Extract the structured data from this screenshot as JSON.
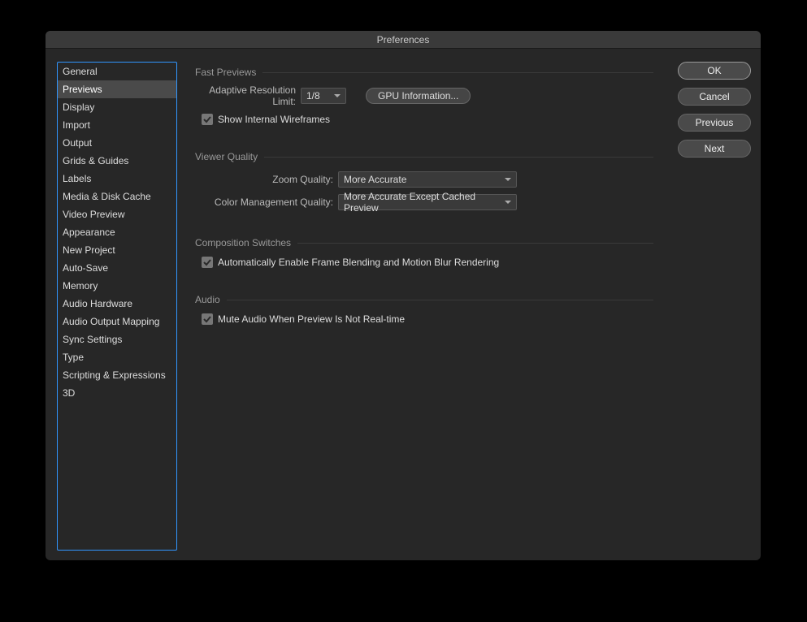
{
  "dialog": {
    "title": "Preferences"
  },
  "sidebar": {
    "items": [
      {
        "label": "General",
        "selected": false
      },
      {
        "label": "Previews",
        "selected": true
      },
      {
        "label": "Display",
        "selected": false
      },
      {
        "label": "Import",
        "selected": false
      },
      {
        "label": "Output",
        "selected": false
      },
      {
        "label": "Grids & Guides",
        "selected": false
      },
      {
        "label": "Labels",
        "selected": false
      },
      {
        "label": "Media & Disk Cache",
        "selected": false
      },
      {
        "label": "Video Preview",
        "selected": false
      },
      {
        "label": "Appearance",
        "selected": false
      },
      {
        "label": "New Project",
        "selected": false
      },
      {
        "label": "Auto-Save",
        "selected": false
      },
      {
        "label": "Memory",
        "selected": false
      },
      {
        "label": "Audio Hardware",
        "selected": false
      },
      {
        "label": "Audio Output Mapping",
        "selected": false
      },
      {
        "label": "Sync Settings",
        "selected": false
      },
      {
        "label": "Type",
        "selected": false
      },
      {
        "label": "Scripting & Expressions",
        "selected": false
      },
      {
        "label": "3D",
        "selected": false
      }
    ]
  },
  "panels": {
    "fastPreviews": {
      "title": "Fast Previews",
      "adaptiveLabel": "Adaptive Resolution Limit:",
      "adaptiveValue": "1/8",
      "gpuButton": "GPU Information...",
      "wireframesLabel": "Show Internal Wireframes",
      "wireframesChecked": true
    },
    "viewerQuality": {
      "title": "Viewer Quality",
      "zoomLabel": "Zoom Quality:",
      "zoomValue": "More Accurate",
      "cmLabel": "Color Management Quality:",
      "cmValue": "More Accurate Except Cached Preview"
    },
    "compSwitches": {
      "title": "Composition Switches",
      "autoLabel": "Automatically Enable Frame Blending and Motion Blur Rendering",
      "autoChecked": true
    },
    "audio": {
      "title": "Audio",
      "muteLabel": "Mute Audio When Preview Is Not Real-time",
      "muteChecked": true
    }
  },
  "buttons": {
    "ok": "OK",
    "cancel": "Cancel",
    "prev": "Previous",
    "next": "Next"
  }
}
